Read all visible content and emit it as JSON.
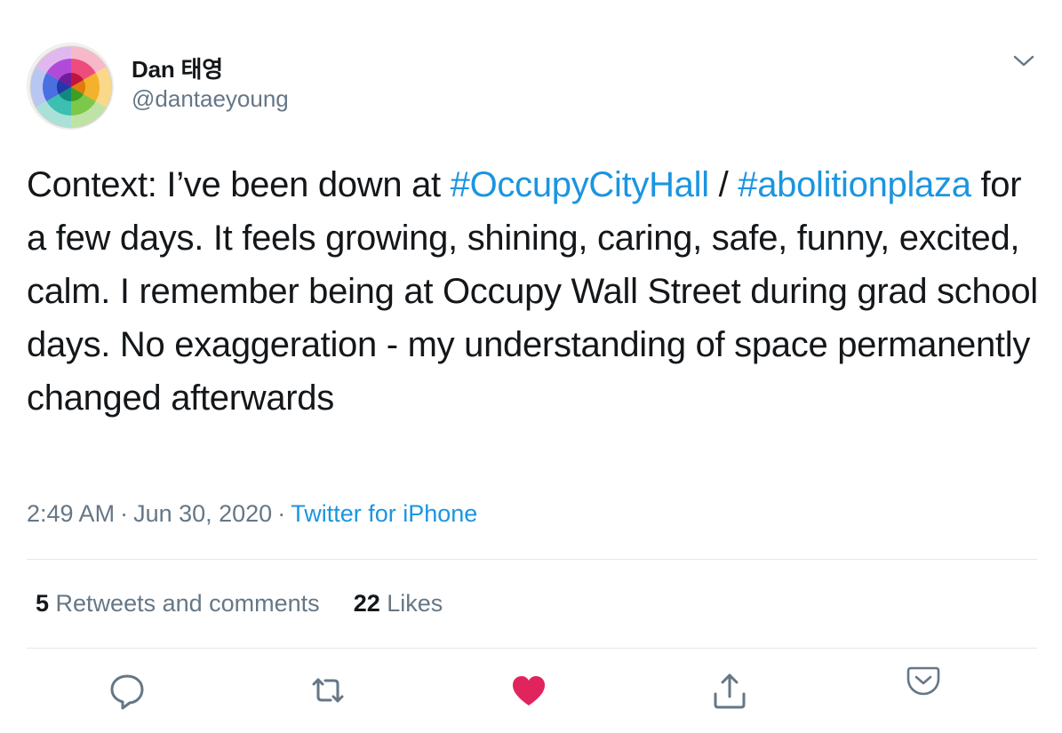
{
  "author": {
    "name": "Dan 태영",
    "handle": "@dantaeyoung"
  },
  "tweet": {
    "segments": [
      {
        "text": "Context: I’ve been down at ",
        "type": "text"
      },
      {
        "text": "#OccupyCityHall",
        "type": "hashtag"
      },
      {
        "text": " / ",
        "type": "text"
      },
      {
        "text": "#abolitionplaza",
        "type": "hashtag"
      },
      {
        "text": " for a few days. It feels growing, shining, caring, safe, funny, excited, calm. I remember being at Occupy Wall Street during grad school days. No exaggeration - my understanding of space permanently changed afterwards",
        "type": "text"
      }
    ]
  },
  "meta": {
    "time": "2:49 AM",
    "separator": "·",
    "date": "Jun 30, 2020",
    "source": "Twitter for iPhone"
  },
  "stats": {
    "retweets_count": "5",
    "retweets_label": "Retweets and comments",
    "likes_count": "22",
    "likes_label": "Likes"
  },
  "actions": {
    "reply_icon": "speech-bubble",
    "retweet_icon": "retweet-arrows",
    "like_icon": "heart-filled",
    "share_icon": "share-arrow-up",
    "more_icon": "pocket-chevron"
  },
  "colors": {
    "link": "#1b95e0",
    "secondary": "#657786",
    "like": "#e0245e",
    "text": "#14171a"
  }
}
